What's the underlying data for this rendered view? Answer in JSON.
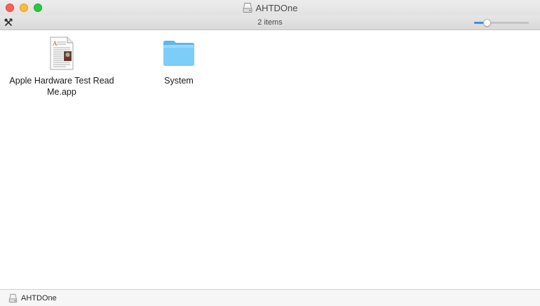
{
  "window": {
    "title": "AHTDOne",
    "title_icon": "drive-icon"
  },
  "toolbar": {
    "item_count": "2 items",
    "tools_icon": "tools-icon",
    "icon_size_level": 0.2
  },
  "items": [
    {
      "name": "Apple Hardware Test Read Me.app",
      "icon": "document-app-icon"
    },
    {
      "name": "System",
      "icon": "folder-icon"
    }
  ],
  "pathbar": {
    "label": "AHTDOne",
    "icon": "drive-icon"
  },
  "colors": {
    "close": "#fe5f57",
    "minimize": "#febc2e",
    "zoom": "#28c840",
    "accent": "#3b8ef0",
    "folder": "#6ec6f5"
  }
}
